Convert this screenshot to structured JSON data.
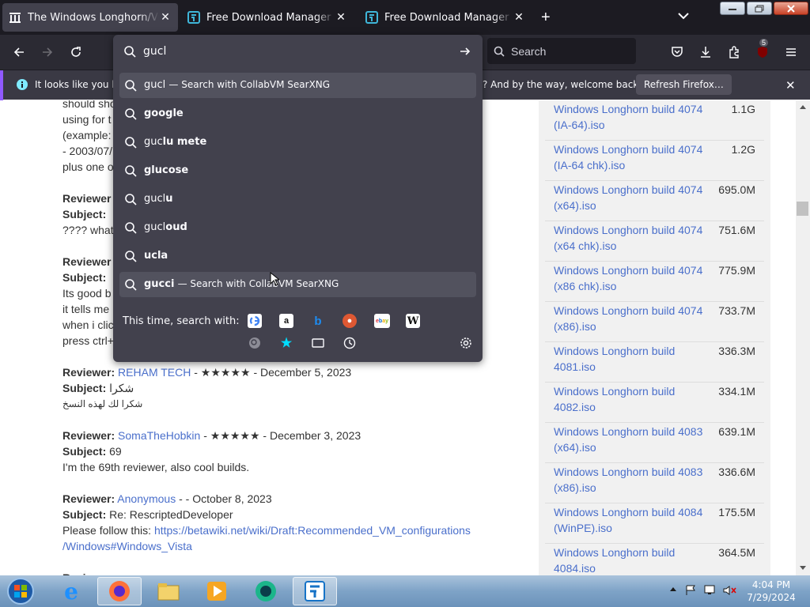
{
  "tabs": [
    {
      "title": "The Windows Longhorn/Vista Archive",
      "active": true
    },
    {
      "title": "Free Download Manager for Windows",
      "active": false
    },
    {
      "title": "Free Download Manager - absolute",
      "active": false
    }
  ],
  "nav": {
    "url_value": "gucl",
    "search_placeholder": "Search",
    "extension_badge": "5"
  },
  "notification": {
    "text_left": "It looks like you ha",
    "text_right": "? And by the way, welcome back!",
    "button": "Refresh Firefox…"
  },
  "urlbar": {
    "suggestions": [
      {
        "pre": "gucl",
        "bold": "",
        "action": "Search with CollabVM SearXNG",
        "highlight": true
      },
      {
        "pre": "",
        "bold": "google",
        "action": "",
        "highlight": false
      },
      {
        "pre": "guc",
        "bold": "lu mete",
        "action": "",
        "highlight": false
      },
      {
        "pre": "",
        "bold": "glucose",
        "action": "",
        "highlight": false
      },
      {
        "pre": "gucl",
        "bold": "u",
        "action": "",
        "highlight": false
      },
      {
        "pre": "gucl",
        "bold": "oud",
        "action": "",
        "highlight": false
      },
      {
        "pre": "",
        "bold": "ucla",
        "action": "",
        "highlight": false
      },
      {
        "pre": "",
        "bold": "gucci",
        "action": "Search with CollabVM SearXNG",
        "highlight": true
      }
    ],
    "one_time_label": "This time, search with:",
    "engines": [
      "google-icon",
      "amazon-icon",
      "bing-icon",
      "duckduckgo-icon",
      "ebay-icon",
      "wikipedia-icon"
    ],
    "modes": [
      "searxng-icon",
      "bookmarks-icon",
      "tabs-icon",
      "history-icon"
    ]
  },
  "page": {
    "partial_lines": [
      "should sho",
      "using for t",
      "(example:",
      "- 2003/07/",
      "plus one o"
    ],
    "partial_reviewer_1": {
      "label": "Reviewer",
      "subject": "Subject:",
      "text": "???? what"
    },
    "partial_reviewer_2": {
      "label": "Reviewer",
      "subject": "Subject:",
      "lines": [
        "Its good b",
        "it tells me",
        "when i clic",
        "press ctrl+"
      ]
    },
    "reviews": [
      {
        "reviewer_label": "Reviewer:",
        "name": "REHAM TECH",
        "meta": " - ★★★★★ - December 5, 2023",
        "subject_label": "Subject:",
        "subject": "شكرا",
        "body": "شكرا لك لهذه النسخ",
        "rtl": true
      },
      {
        "reviewer_label": "Reviewer:",
        "name": "SomaTheHobkin",
        "meta": " - ★★★★★ - December 3, 2023",
        "subject_label": "Subject:",
        "subject": "69",
        "body": "I'm the 69th reviewer, also cool builds.",
        "rtl": false
      },
      {
        "reviewer_label": "Reviewer:",
        "name": "Anonymous",
        "meta": " - - October 8, 2023",
        "subject_label": "Subject:",
        "subject": "Re: RescriptedDeveloper",
        "body": "Please follow this: ",
        "link": "https://betawiki.net/wiki/Draft:Recommended_VM_configurations/Windows#Windows_Vista",
        "link_line1": "https://betawiki.net/wiki/Draft:Recommended_VM_configurations",
        "link_line2": "/Windows#Windows_Vista",
        "rtl": false
      }
    ],
    "files": [
      {
        "name": "Windows Longhorn build 4074 (IA-64).iso",
        "size": "1.1G"
      },
      {
        "name": "Windows Longhorn build 4074 (IA-64 chk).iso",
        "size": "1.2G"
      },
      {
        "name": "Windows Longhorn build 4074 (x64).iso",
        "size": "695.0M"
      },
      {
        "name": "Windows Longhorn build 4074 (x64 chk).iso",
        "size": "751.6M"
      },
      {
        "name": "Windows Longhorn build 4074 (x86 chk).iso",
        "size": "775.9M"
      },
      {
        "name": "Windows Longhorn build 4074 (x86).iso",
        "size": "733.7M"
      },
      {
        "name": "Windows Longhorn build 4081.iso",
        "size": "336.3M"
      },
      {
        "name": "Windows Longhorn build 4082.iso",
        "size": "334.1M"
      },
      {
        "name": "Windows Longhorn build 4083 (x64).iso",
        "size": "639.1M"
      },
      {
        "name": "Windows Longhorn build 4083 (x86).iso",
        "size": "336.6M"
      },
      {
        "name": "Windows Longhorn build 4084 (WinPE).iso",
        "size": "175.5M"
      },
      {
        "name": "Windows Longhorn build 4084.iso",
        "size": "364.5M"
      }
    ]
  },
  "taskbar": {
    "items": [
      "start-orb",
      "internet-explorer-icon",
      "firefox-icon",
      "explorer-icon",
      "media-player-icon",
      "collabvm-icon",
      "fdm-icon"
    ],
    "time": "4:04 PM",
    "date": "7/29/2024"
  }
}
